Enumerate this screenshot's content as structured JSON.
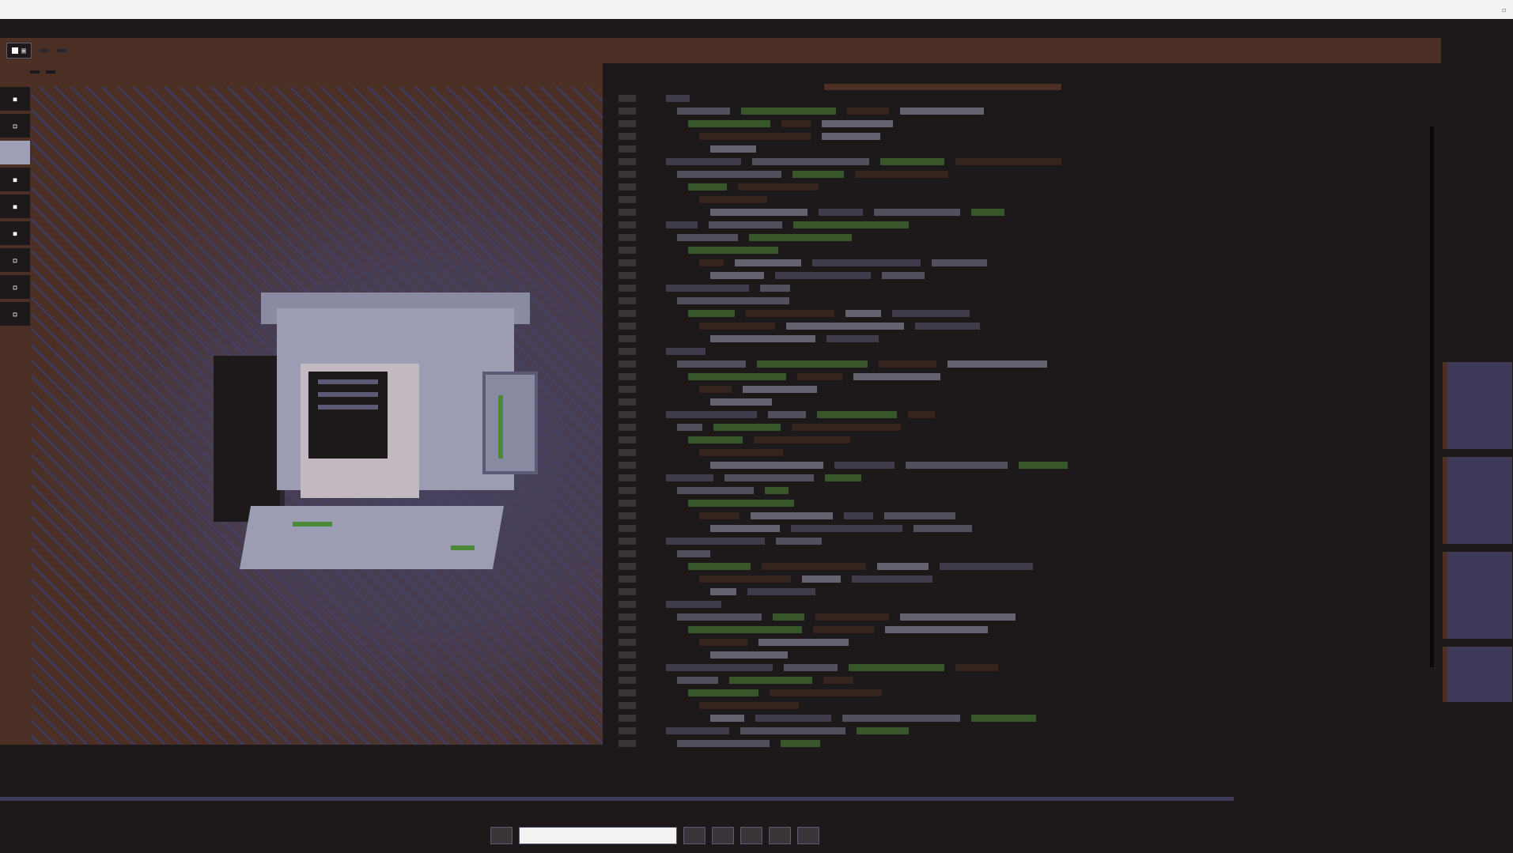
{
  "window": {
    "title": "",
    "close_glyph": "▫"
  },
  "toolbar": {
    "left_chip": "▣",
    "mode_a": "",
    "mode_b": "",
    "right_a": "",
    "right_b": ""
  },
  "left": {
    "tools": [
      {
        "name": "move",
        "glyph": "▪"
      },
      {
        "name": "pencil",
        "glyph": "▫"
      },
      {
        "name": "select",
        "glyph": ""
      },
      {
        "name": "fill",
        "glyph": "▪"
      },
      {
        "name": "eyedropper",
        "glyph": "▪"
      },
      {
        "name": "eraser",
        "glyph": "▪"
      },
      {
        "name": "line",
        "glyph": "▫"
      },
      {
        "name": "shape",
        "glyph": "▫"
      },
      {
        "name": "text",
        "glyph": "▫"
      }
    ],
    "status": ""
  },
  "code": {
    "tabs": [
      "",
      "",
      ""
    ]
  },
  "colors": {
    "bg": "#1d191a",
    "brown": "#4b2f25",
    "purple": "#403a5a",
    "gray": "#9fa0b7",
    "green": "#4c8a3a"
  }
}
